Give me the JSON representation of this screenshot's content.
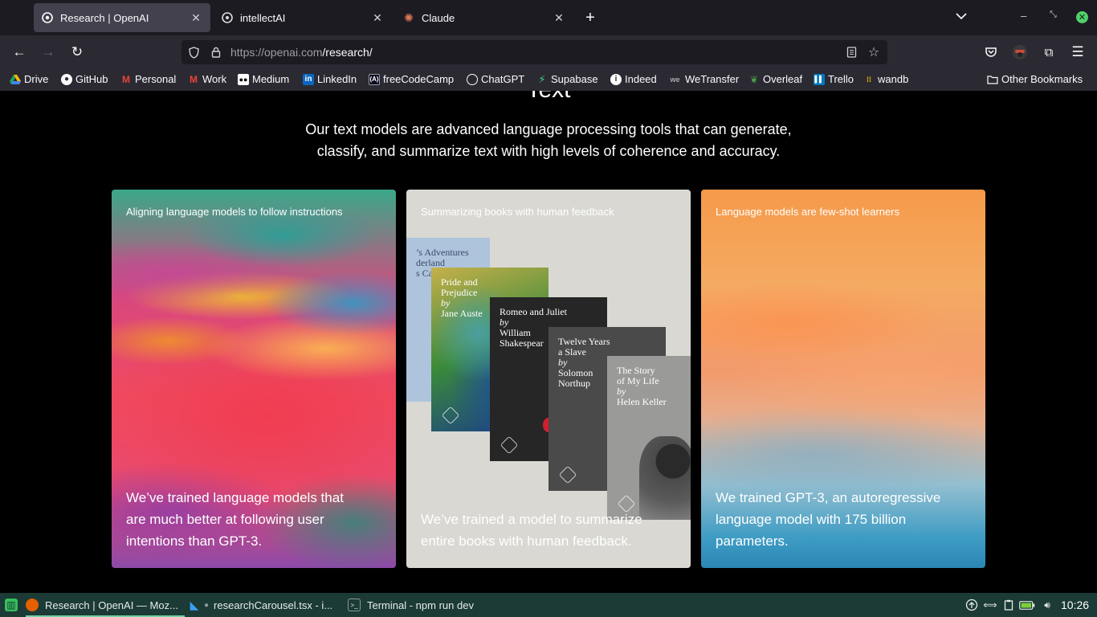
{
  "browser": {
    "tabs": [
      {
        "label": "Research | OpenAI",
        "icon": "openai-icon",
        "active": true
      },
      {
        "label": "intellectAI",
        "icon": "intellectai-icon",
        "active": false
      },
      {
        "label": "Claude",
        "icon": "claude-icon",
        "active": false
      }
    ],
    "url_host": "https://openai.com",
    "url_path": "/research/",
    "bookmarks": [
      {
        "label": "Drive",
        "icon": "drive-icon",
        "color": "#1fa463"
      },
      {
        "label": "GitHub",
        "icon": "github-icon",
        "color": "#444"
      },
      {
        "label": "Personal",
        "icon": "gmail-icon",
        "color": "#ea4335"
      },
      {
        "label": "Work",
        "icon": "gmail-icon",
        "color": "#ea4335"
      },
      {
        "label": "Medium",
        "icon": "medium-icon",
        "color": "#000"
      },
      {
        "label": "LinkedIn",
        "icon": "linkedin-icon",
        "color": "#0a66c2"
      },
      {
        "label": "freeCodeCamp",
        "icon": "freecodecamp-icon",
        "color": "#0a0a23"
      },
      {
        "label": "ChatGPT",
        "icon": "chatgpt-icon",
        "color": "#555"
      },
      {
        "label": "Supabase",
        "icon": "supabase-icon",
        "color": "#3ecf8e"
      },
      {
        "label": "Indeed",
        "icon": "indeed-icon",
        "color": "#fff"
      },
      {
        "label": "WeTransfer",
        "icon": "wetransfer-icon",
        "color": "#222"
      },
      {
        "label": "Overleaf",
        "icon": "overleaf-icon",
        "color": "#47a141"
      },
      {
        "label": "Trello",
        "icon": "trello-icon",
        "color": "#0079bf"
      },
      {
        "label": "wandb",
        "icon": "wandb-icon",
        "color": "#ffbe00"
      }
    ],
    "other_bookmarks": "Other Bookmarks"
  },
  "page": {
    "section_heading": "Text",
    "section_desc_line1": "Our text models are advanced language processing tools that can generate,",
    "section_desc_line2": "classify, and summarize text with high levels of coherence and accuracy.",
    "cards": [
      {
        "title": "Aligning language models to follow instructions",
        "desc": "We’ve trained language models that are much better at following user intentions than GPT-3."
      },
      {
        "title": "Summarizing books with human feedback",
        "desc": "We’ve trained a model to summarize entire books with human feedback."
      },
      {
        "title": "Language models are few-shot learners",
        "desc": "We trained GPT-3, an autoregressive language model with 175 billion parameters."
      }
    ],
    "books": [
      {
        "title": "’s Adventures\nderland",
        "author": "s Carr"
      },
      {
        "title": "Pride and\nPrejudice",
        "by": "by",
        "author": "Jane Auste"
      },
      {
        "title": "Romeo and Juliet",
        "by": "by",
        "author": "William\nShakespear"
      },
      {
        "title": "Twelve Years\na Slave",
        "by": "by",
        "author": "Solomon\nNorthup"
      },
      {
        "title": "The Story\nof My Life",
        "by": "by",
        "author": "Helen Keller"
      }
    ]
  },
  "taskbar": {
    "items": [
      {
        "label": "Research | OpenAI — Moz...",
        "icon": "firefox-icon"
      },
      {
        "label": "researchCarousel.tsx - i...",
        "icon": "vscode-icon"
      },
      {
        "label": "Terminal - npm run dev",
        "icon": "terminal-icon"
      }
    ],
    "clock": "10:26"
  }
}
